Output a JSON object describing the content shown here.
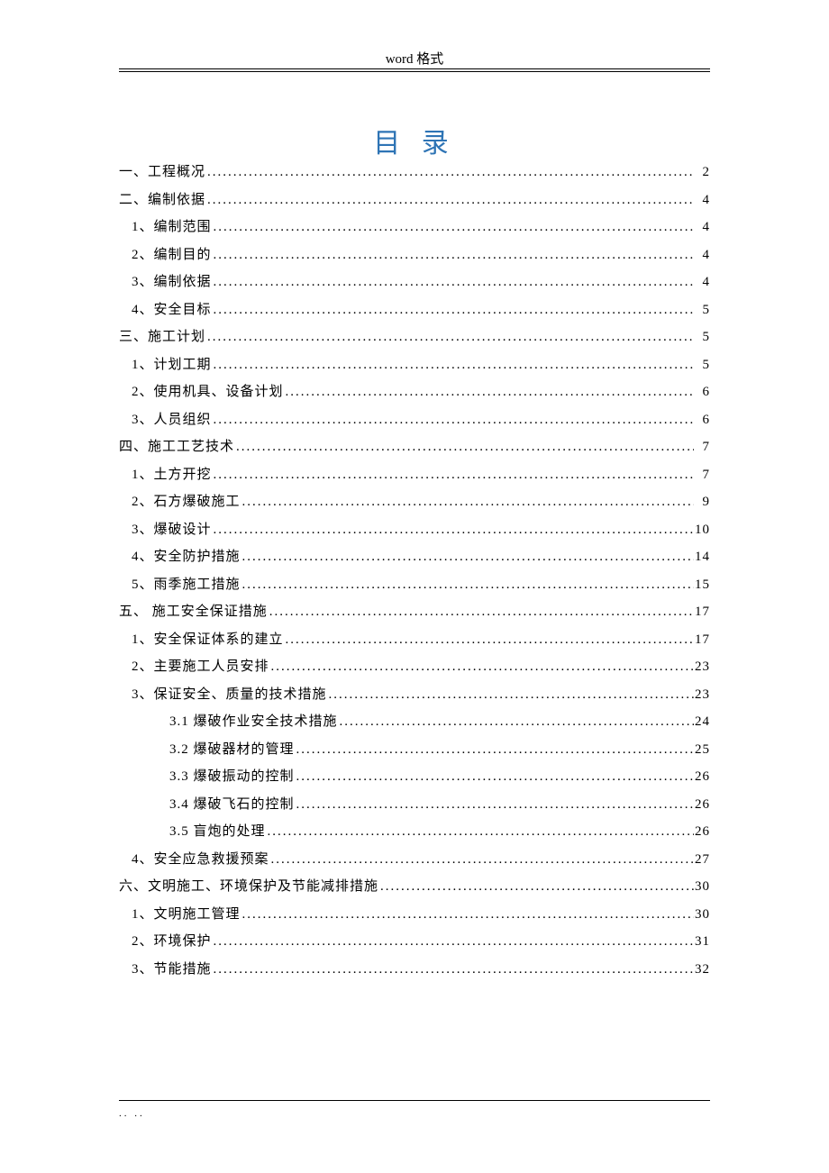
{
  "header": "word 格式",
  "title": "目 录",
  "footer": ".. ..",
  "toc": [
    {
      "level": 0,
      "label": "一、工程概况",
      "page": "2"
    },
    {
      "level": 0,
      "label": "二、编制依据",
      "page": "4"
    },
    {
      "level": 1,
      "label": "1、编制范围",
      "page": "4"
    },
    {
      "level": 1,
      "label": "2、编制目的",
      "page": "4"
    },
    {
      "level": 1,
      "label": "3、编制依据",
      "page": "4"
    },
    {
      "level": 1,
      "label": "4、安全目标",
      "page": "5"
    },
    {
      "level": 0,
      "label": "三、施工计划",
      "page": "5"
    },
    {
      "level": 1,
      "label": "1、计划工期",
      "page": "5"
    },
    {
      "level": 1,
      "label": "2、使用机具、设备计划",
      "page": "6"
    },
    {
      "level": 1,
      "label": "3、人员组织",
      "page": "6"
    },
    {
      "level": 0,
      "label": "四、施工工艺技术",
      "page": "7"
    },
    {
      "level": 1,
      "label": "1、土方开挖",
      "page": "7"
    },
    {
      "level": 1,
      "label": "2、石方爆破施工",
      "page": "9"
    },
    {
      "level": 1,
      "label": "3、爆破设计",
      "page": "10"
    },
    {
      "level": 1,
      "label": "4、安全防护措施",
      "page": "14"
    },
    {
      "level": 1,
      "label": "5、雨季施工措施",
      "page": "15"
    },
    {
      "level": 0,
      "label": "五、 施工安全保证措施",
      "page": "17"
    },
    {
      "level": 1,
      "label": "1、安全保证体系的建立",
      "page": "17"
    },
    {
      "level": 1,
      "label": "2、主要施工人员安排",
      "page": "23"
    },
    {
      "level": 1,
      "label": "3、保证安全、质量的技术措施",
      "page": "23"
    },
    {
      "level": 2,
      "label": "3.1 爆破作业安全技术措施 ",
      "page": "24"
    },
    {
      "level": 2,
      "label": "3.2 爆破器材的管理 ",
      "page": "25"
    },
    {
      "level": 2,
      "label": "3.3 爆破振动的控制 ",
      "page": "26"
    },
    {
      "level": 2,
      "label": "3.4 爆破飞石的控制 ",
      "page": "26"
    },
    {
      "level": 2,
      "label": "3.5 盲炮的处理 ",
      "page": "26"
    },
    {
      "level": 1,
      "label": "4、安全应急救援预案",
      "page": "27"
    },
    {
      "level": 0,
      "label": "六、文明施工、环境保护及节能减排措施",
      "page": "30"
    },
    {
      "level": 1,
      "label": "1、文明施工管理",
      "page": "30"
    },
    {
      "level": 1,
      "label": "2、环境保护",
      "page": "31"
    },
    {
      "level": 1,
      "label": "3、节能措施",
      "page": "32"
    }
  ]
}
